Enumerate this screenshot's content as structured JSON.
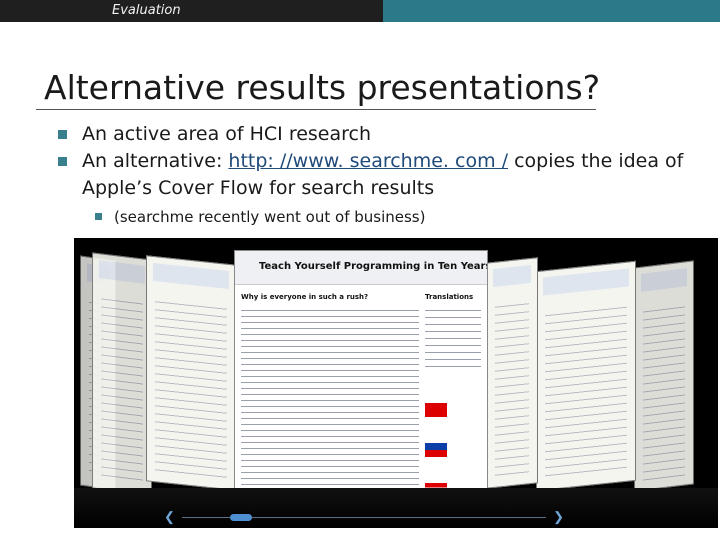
{
  "header": {
    "section_label": "Evaluation"
  },
  "slide": {
    "title": "Alternative results presentations?",
    "bullets": [
      {
        "text": "An active area of HCI research"
      },
      {
        "text_before": "An alternative: ",
        "link": "http: //www. searchme. com /",
        "text_after": " copies the idea of Apple’s Cover Flow for search results"
      }
    ],
    "sub_bullet": "(searchme recently went out of business)"
  },
  "screenshot": {
    "main_page_title": "Teach Yourself Programming in Ten Years",
    "main_heading": "Why is everyone in such a rush?",
    "sidebar_heading": "Translations",
    "scroll_position": 0.14
  },
  "colors": {
    "header_dark": "#1f1f1f",
    "header_accent": "#2b7a8a",
    "bullet_marker": "#3a7f8c",
    "link": "#1f4a7a",
    "scroll_thumb": "#4d8fd0"
  },
  "icons": {
    "bullet": "square-bullet-icon",
    "scroll_left": "chevron-left-icon",
    "scroll_right": "chevron-right-icon",
    "zoom": "magnifier-icon"
  }
}
